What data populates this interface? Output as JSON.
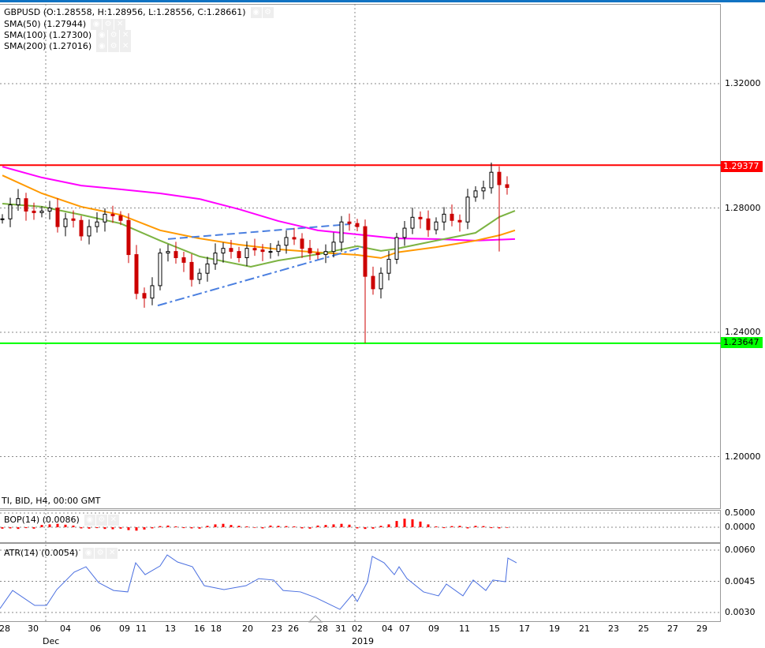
{
  "legend": {
    "symbol": "GBPUSD (O:1.28558, H:1.28956, L:1.28556, C:1.28661)",
    "sma50": "SMA(50) (1.27944)",
    "sma100": "SMA(100) (1.27300)",
    "sma200": "SMA(200) (1.27016)",
    "info": "TI, BID, H4, 00:00 GMT",
    "bop": "BOP(14) (0.0086)",
    "atr": "ATR(14) (0.0054)"
  },
  "colors": {
    "resistance": "#ff0000",
    "support": "#00ff00",
    "sma50": "#7cb342",
    "sma100": "#ff9900",
    "sma200": "#ff00ff",
    "trend": "#4a7fe0",
    "atr": "#4a6fe0",
    "bop": "#ff0000"
  },
  "chart_data": {
    "type": "candlestick",
    "price_ticks": [
      "1.32000",
      "1.28000",
      "1.24000",
      "1.20000"
    ],
    "ylim": [
      1.1995,
      1.3411
    ],
    "levels": {
      "resistance": "1.29377",
      "support": "1.23647"
    },
    "close": [
      1.2765,
      1.281,
      1.283,
      1.279,
      1.2785,
      1.279,
      1.28,
      1.274,
      1.2765,
      1.276,
      1.271,
      1.274,
      1.2755,
      1.278,
      1.2775,
      1.276,
      1.265,
      1.2525,
      1.251,
      1.255,
      1.2655,
      1.266,
      1.264,
      1.2625,
      1.257,
      1.259,
      1.262,
      1.2655,
      1.267,
      1.266,
      1.264,
      1.267,
      1.2665,
      1.266,
      1.266,
      1.268,
      1.2705,
      1.27,
      1.267,
      1.2655,
      1.265,
      1.266,
      1.269,
      1.2755,
      1.275,
      1.274,
      1.258,
      1.254,
      1.259,
      1.2635,
      1.2705,
      1.2735,
      1.277,
      1.2765,
      1.273,
      1.2755,
      1.278,
      1.276,
      1.2755,
      1.2835,
      1.2855,
      1.2865,
      1.2915,
      1.2875,
      1.2866
    ],
    "wick_lows": {
      "46": 1.2365,
      "63": 1.266
    },
    "sma50": [
      [
        0,
        1.2814
      ],
      [
        5,
        1.2804
      ],
      [
        10,
        1.2778
      ],
      [
        15,
        1.275
      ],
      [
        20,
        1.2695
      ],
      [
        25,
        1.2644
      ],
      [
        31.5,
        1.2611
      ],
      [
        35,
        1.2631
      ],
      [
        40,
        1.2651
      ],
      [
        45,
        1.2677
      ],
      [
        48,
        1.2662
      ],
      [
        50,
        1.2669
      ],
      [
        55,
        1.2695
      ],
      [
        60,
        1.272
      ],
      [
        63,
        1.2771
      ],
      [
        65,
        1.2791
      ]
    ],
    "sma100": [
      [
        0,
        1.2905
      ],
      [
        5,
        1.2847
      ],
      [
        10,
        1.2804
      ],
      [
        15,
        1.2778
      ],
      [
        20,
        1.2728
      ],
      [
        25,
        1.2702
      ],
      [
        30,
        1.2682
      ],
      [
        35,
        1.2667
      ],
      [
        40,
        1.2657
      ],
      [
        45,
        1.2649
      ],
      [
        48,
        1.2639
      ],
      [
        50,
        1.2657
      ],
      [
        55,
        1.2674
      ],
      [
        60,
        1.2695
      ],
      [
        63,
        1.2712
      ],
      [
        65,
        1.2728
      ]
    ],
    "sma200": [
      [
        0,
        1.2933
      ],
      [
        5,
        1.2898
      ],
      [
        10,
        1.2872
      ],
      [
        15,
        1.286
      ],
      [
        20,
        1.2847
      ],
      [
        25,
        1.2829
      ],
      [
        30,
        1.2796
      ],
      [
        35,
        1.2758
      ],
      [
        40,
        1.2728
      ],
      [
        45,
        1.2715
      ],
      [
        50,
        1.2702
      ],
      [
        55,
        1.27
      ],
      [
        60,
        1.2695
      ],
      [
        65,
        1.27
      ]
    ],
    "trendlines": [
      {
        "style": "dashed",
        "from": [
          21,
          1.27
        ],
        "to": [
          44.1,
          1.2748
        ]
      },
      {
        "style": "dashdot",
        "from": [
          19.7,
          1.2486
        ],
        "to": [
          45.7,
          1.2674
        ]
      }
    ],
    "x_ticks": [
      [
        0.2,
        "28"
      ],
      [
        3.8,
        "30"
      ],
      [
        7.9,
        "04"
      ],
      [
        11.7,
        "06"
      ],
      [
        15.4,
        "09"
      ],
      [
        17.5,
        "11"
      ],
      [
        21.2,
        "13"
      ],
      [
        24.9,
        "16"
      ],
      [
        27,
        "18"
      ],
      [
        31,
        "20"
      ],
      [
        34.7,
        "23"
      ],
      [
        36.8,
        "26"
      ],
      [
        40.5,
        "28"
      ],
      [
        42.8,
        "31"
      ],
      [
        44.9,
        "02"
      ],
      [
        48.7,
        "04"
      ],
      [
        50.9,
        "07"
      ],
      [
        54.6,
        "09"
      ],
      [
        58.5,
        "11"
      ],
      [
        62.3,
        "15"
      ],
      [
        66.1,
        "17"
      ],
      [
        69.9,
        "19"
      ],
      [
        73.7,
        "21"
      ],
      [
        77.4,
        "23"
      ],
      [
        81.2,
        "25"
      ],
      [
        84.9,
        "27"
      ],
      [
        88.6,
        "29"
      ]
    ],
    "x_major": [
      [
        5.5,
        "Dec"
      ],
      [
        44.7,
        "2019"
      ]
    ],
    "bop": {
      "ticks": [
        "0.5000",
        "0.0000"
      ],
      "values": [
        -0.05,
        -0.04,
        -0.06,
        -0.03,
        -0.05,
        0.08,
        0.1,
        0.12,
        0.09,
        0.06,
        -0.04,
        -0.05,
        -0.03,
        -0.06,
        -0.07,
        -0.05,
        -0.1,
        -0.12,
        -0.08,
        -0.04,
        0.04,
        0.06,
        0.03,
        -0.03,
        -0.04,
        -0.05,
        0.05,
        0.1,
        0.12,
        0.08,
        0.05,
        0.03,
        -0.02,
        -0.04,
        0.06,
        0.05,
        0.04,
        0.03,
        -0.04,
        -0.05,
        0.06,
        0.08,
        0.1,
        0.12,
        0.09,
        -0.04,
        -0.06,
        -0.05,
        0.05,
        0.1,
        0.22,
        0.3,
        0.28,
        0.2,
        0.1,
        0.03,
        -0.03,
        0.04,
        0.05,
        -0.04,
        0.05,
        0.04,
        -0.03,
        -0.04,
        -0.02
      ]
    },
    "atr": {
      "ticks": [
        "0.0060",
        "0.0045",
        "0.0030"
      ],
      "points": [
        [
          -0.3,
          0.00319
        ],
        [
          1.3,
          0.00406
        ],
        [
          4.1,
          0.00334
        ],
        [
          5.6,
          0.00334
        ],
        [
          6.9,
          0.0041
        ],
        [
          9.1,
          0.00494
        ],
        [
          10.6,
          0.0052
        ],
        [
          12.2,
          0.00444
        ],
        [
          14.1,
          0.00406
        ],
        [
          15.9,
          0.00399
        ],
        [
          16.9,
          0.00539
        ],
        [
          18.1,
          0.00482
        ],
        [
          20,
          0.00524
        ],
        [
          20.9,
          0.00577
        ],
        [
          22.2,
          0.00543
        ],
        [
          24.1,
          0.0052
        ],
        [
          25.6,
          0.00429
        ],
        [
          28.1,
          0.0041
        ],
        [
          30.9,
          0.00429
        ],
        [
          32.5,
          0.00463
        ],
        [
          34.4,
          0.00456
        ],
        [
          35.6,
          0.00406
        ],
        [
          37.8,
          0.00399
        ],
        [
          39.7,
          0.00372
        ],
        [
          42.8,
          0.00315
        ],
        [
          44.4,
          0.00387
        ],
        [
          45,
          0.00353
        ],
        [
          46.3,
          0.00448
        ],
        [
          46.9,
          0.0057
        ],
        [
          48.4,
          0.00539
        ],
        [
          49.7,
          0.00482
        ],
        [
          50.3,
          0.0052
        ],
        [
          51.3,
          0.00463
        ],
        [
          53.4,
          0.00399
        ],
        [
          55.3,
          0.0038
        ],
        [
          56.3,
          0.00437
        ],
        [
          58.4,
          0.0038
        ],
        [
          59.7,
          0.00456
        ],
        [
          61.3,
          0.00406
        ],
        [
          62.2,
          0.00456
        ],
        [
          63.8,
          0.00448
        ],
        [
          64.1,
          0.00562
        ],
        [
          65.2,
          0.00539
        ]
      ]
    }
  }
}
